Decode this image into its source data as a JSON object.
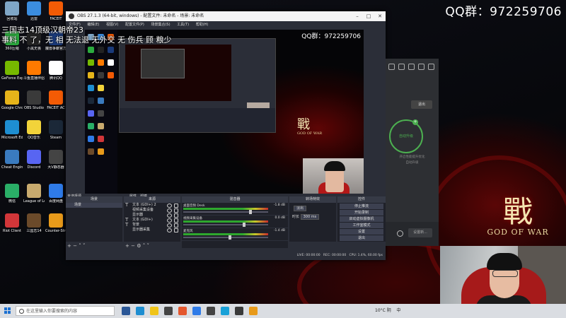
{
  "overlay": {
    "qq_group": "QQ群：972259706",
    "game_title": "三国志14顶级汉朝帝23",
    "scroll_text": "事料 不 了，无 相 无法退 无外交 无 伤兵 顾 粮少",
    "wallpaper_logo_zh": "戰",
    "wallpaper_logo_en": "GOD OF WAR"
  },
  "desktop_icons": [
    {
      "label": "回收站",
      "color": "#7fa6c7"
    },
    {
      "label": "迅雷",
      "color": "#3b8de0"
    },
    {
      "label": "FACEIT",
      "color": "#f35b05"
    },
    {
      "label": "360压缩",
      "color": "#2bab3e"
    },
    {
      "label": "小黑无畏",
      "color": "#222222"
    },
    {
      "label": "魔兽争霸官方对战平台",
      "color": "#1a3a7a"
    },
    {
      "label": "GeForce Experience",
      "color": "#76b900"
    },
    {
      "label": "斗鱼直播伴侣",
      "color": "#ff7a00"
    },
    {
      "label": "腾讯QQ",
      "color": "#ffffff"
    },
    {
      "label": "Google Chrome",
      "color": "#e6b41a"
    },
    {
      "label": "OBS Studio",
      "color": "#3a3a3a"
    },
    {
      "label": "FACEIT AC",
      "color": "#f35b05"
    },
    {
      "label": "Microsoft Edge",
      "color": "#1e8ed1"
    },
    {
      "label": "QQ音乐",
      "color": "#f2d33a"
    },
    {
      "label": "Steam",
      "color": "#1b2838"
    },
    {
      "label": "Cheat Engine",
      "color": "#3a7bbf"
    },
    {
      "label": "Discord",
      "color": "#5865f2"
    },
    {
      "label": "大V静态器",
      "color": "#444444"
    },
    {
      "label": "微信",
      "color": "#2aae67"
    },
    {
      "label": "League of Legends",
      "color": "#c8aa6e"
    },
    {
      "label": "百度网盘",
      "color": "#2f7be8"
    },
    {
      "label": "Riot Client",
      "color": "#d13639"
    },
    {
      "label": "三国志14",
      "color": "#6b4a2a"
    },
    {
      "label": "Counter-Strike: Global Offe...",
      "color": "#e89a1a"
    }
  ],
  "obs": {
    "window_title": "OBS 27.1.3 (64-bit, windows) - 配置文件: 未命名 - 场景: 未命名",
    "menu": [
      "文件(F)",
      "编辑(E)",
      "视图(V)",
      "配置文件(P)",
      "场景集合(S)",
      "工具(T)",
      "帮助(H)"
    ],
    "preview_qq": "QQ群：972259706",
    "preview_logo_zh": "戰",
    "preview_logo_en": "GOD OF WAR",
    "no_source_label": "未选择源",
    "properties_label": "属性",
    "filters_label": "滤镜",
    "docks": {
      "scenes_title": "场景",
      "sources_title": "来源",
      "mixer_title": "混音器",
      "transitions_title": "转场特效",
      "controls_title": "控件"
    },
    "scenes": [
      "场景"
    ],
    "sources": [
      {
        "type": "T",
        "name": "文本 (GDI+) 2"
      },
      {
        "type": "",
        "name": "视频采集设备"
      },
      {
        "type": "",
        "name": "显示器"
      },
      {
        "type": "T",
        "name": "文本 (GDI+)"
      },
      {
        "type": "T",
        "name": "背景"
      },
      {
        "type": "",
        "name": "显示器采集"
      }
    ],
    "mixer": [
      {
        "name": "桌面音频 Desk",
        "db": "-1.8 dB",
        "level": 0.8
      },
      {
        "name": "视频采集设备",
        "db": "0.0 dB",
        "level": 0.72
      },
      {
        "name": "麦克风",
        "db": "-1.4 dB",
        "level": 0.55
      }
    ],
    "transition": {
      "type": "淡出",
      "duration_label": "时长",
      "duration": "300 ms"
    },
    "controls": [
      "停止推流",
      "开始录制",
      "启动虚拟摄像机",
      "工作室模式",
      "设置",
      "退出"
    ],
    "status": {
      "live": "LIVE: 00:00:00",
      "rec": "REC: 00:00:00",
      "cpu": "CPU: 1.4%, 60.00 fps"
    }
  },
  "side_app": {
    "button": "退出",
    "circle_label": "自动升级",
    "info_line1": "开启性能提升优化",
    "info_line2": "自动升级",
    "bottom_button": "设置新..."
  },
  "taskbar": {
    "search_placeholder": "在这里输入你要搜索的内容",
    "weather": "10°C 阴",
    "lang": "中",
    "time": "",
    "app_icon_colors": [
      "#2b5797",
      "#1e8ed1",
      "#f0c419",
      "#444444",
      "#e4572e",
      "#2f7be8",
      "#444444",
      "#19a1d8",
      "#3a3a3a",
      "#e89a1a"
    ]
  }
}
